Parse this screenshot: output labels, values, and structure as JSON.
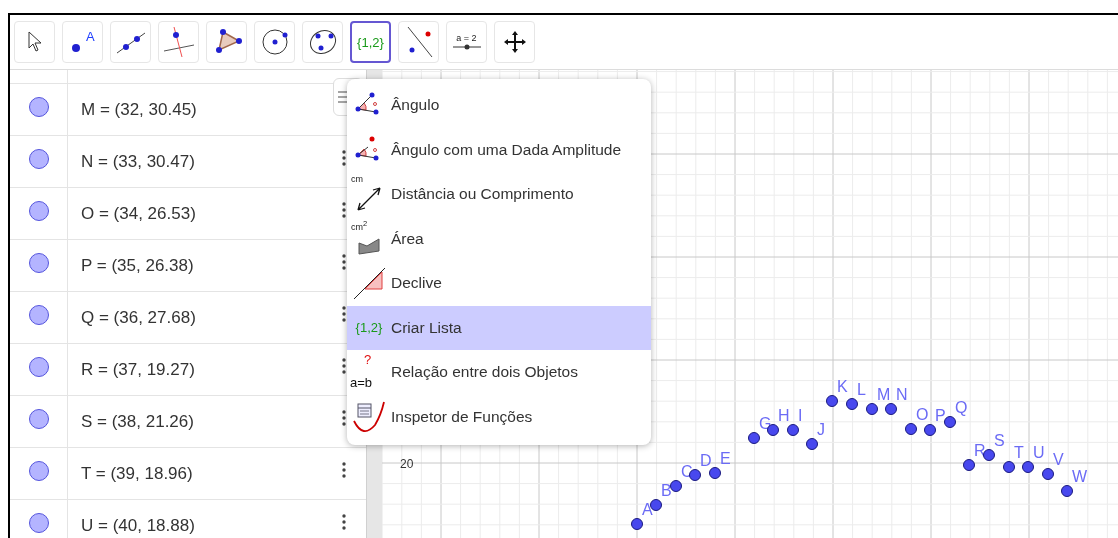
{
  "toolbar": {
    "tools": [
      {
        "kind": "move",
        "selected": false
      },
      {
        "kind": "point",
        "label": "A",
        "selected": false
      },
      {
        "kind": "line",
        "selected": false
      },
      {
        "kind": "perpendicular",
        "selected": false
      },
      {
        "kind": "polygon",
        "selected": false
      },
      {
        "kind": "circle",
        "selected": false
      },
      {
        "kind": "conic",
        "selected": false
      },
      {
        "kind": "list",
        "label": "{1,2}",
        "selected": true
      },
      {
        "kind": "reflect",
        "selected": false
      },
      {
        "kind": "slider",
        "label": "a = 2",
        "selected": false
      },
      {
        "kind": "pan",
        "selected": false
      }
    ]
  },
  "algebra": {
    "rows": [
      {
        "value": "M = (32, 30.45)",
        "visible": true
      },
      {
        "value": "N = (33, 30.47)",
        "visible": true
      },
      {
        "value": "O = (34, 26.53)",
        "visible": true
      },
      {
        "value": "P = (35, 26.38)",
        "visible": true
      },
      {
        "value": "Q = (36, 27.68)",
        "visible": true
      },
      {
        "value": "R = (37, 19.27)",
        "visible": true
      },
      {
        "value": "S = (38, 21.26)",
        "visible": true
      },
      {
        "value": "T = (39, 18.96)",
        "visible": true
      },
      {
        "value": "U = (40, 18.88)",
        "visible": true
      }
    ]
  },
  "menu": {
    "items": [
      {
        "kind": "angle",
        "label": "Ângulo",
        "selected": false
      },
      {
        "kind": "angle_fixed",
        "label": "Ângulo com uma Dada Amplitude",
        "selected": false
      },
      {
        "kind": "distance",
        "icon_text": "cm",
        "label": "Distância ou Comprimento",
        "selected": false
      },
      {
        "kind": "area",
        "icon_text": "cm$^{2}$",
        "label": "Área",
        "selected": false
      },
      {
        "kind": "slope",
        "label": "Declive",
        "selected": false
      },
      {
        "kind": "list",
        "icon_text": "{1,2}",
        "label": "Criar Lista",
        "selected": true
      },
      {
        "kind": "relation",
        "icon_mark": "?",
        "icon_text": "a=b",
        "label": "Relação entre dois Objetos",
        "selected": false
      },
      {
        "kind": "inspector",
        "label": "Inspetor de Funções",
        "selected": false
      }
    ]
  },
  "graph": {
    "y_tick_labels": [
      "20"
    ],
    "points": [
      {
        "label": "A"
      },
      {
        "label": "B"
      },
      {
        "label": "C"
      },
      {
        "label": "D"
      },
      {
        "label": "E"
      },
      {
        "label": "G"
      },
      {
        "label": "H"
      },
      {
        "label": "I"
      },
      {
        "label": "J"
      },
      {
        "label": "K"
      },
      {
        "label": "L"
      },
      {
        "label": "M"
      },
      {
        "label": "N"
      },
      {
        "label": "O"
      },
      {
        "label": "P"
      },
      {
        "label": "Q"
      },
      {
        "label": "R"
      },
      {
        "label": "S"
      },
      {
        "label": "T"
      },
      {
        "label": "U"
      },
      {
        "label": "V"
      },
      {
        "label": "W"
      }
    ]
  }
}
